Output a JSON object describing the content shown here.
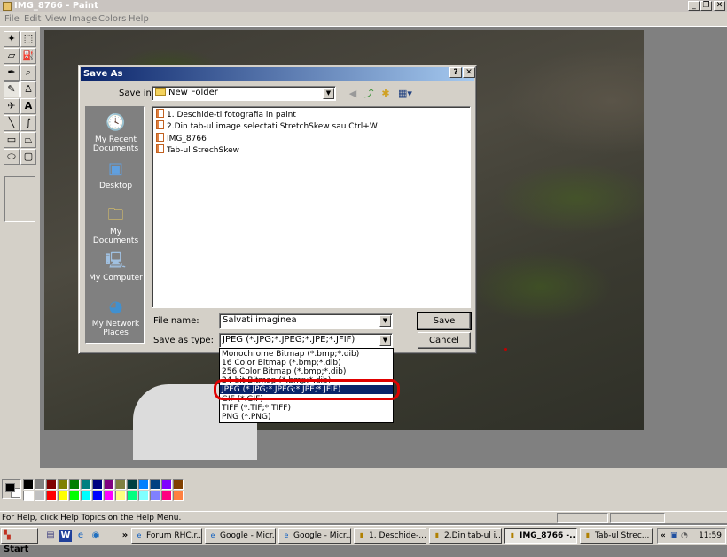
{
  "window": {
    "title": "IMG_8766 - Paint",
    "minimize": "_",
    "restore": "❐",
    "close": "✕"
  },
  "menu": [
    "File",
    "Edit",
    "View",
    "Image",
    "Colors",
    "Help"
  ],
  "toolbox": {
    "tools": [
      "free-form-select",
      "select",
      "eraser",
      "fill-with-color",
      "pick-color",
      "magnifier",
      "pencil",
      "brush",
      "airbrush",
      "text",
      "line",
      "curve",
      "rectangle",
      "polygon",
      "ellipse",
      "rounded-rectangle"
    ],
    "selected": "pencil"
  },
  "dialog": {
    "title": "Save As",
    "help_btn": "?",
    "close_btn": "✕",
    "save_in_label": "Save in:",
    "save_in_value": "New Folder",
    "places": [
      {
        "icon": "recent-documents-icon",
        "label": "My Recent Documents"
      },
      {
        "icon": "desktop-icon",
        "label": "Desktop"
      },
      {
        "icon": "my-documents-icon",
        "label": "My Documents"
      },
      {
        "icon": "my-computer-icon",
        "label": "My Computer"
      },
      {
        "icon": "network-places-icon",
        "label": "My Network Places"
      }
    ],
    "files": [
      "1. Deschide-ti fotografia in paint",
      "2.Din tab-ul image selectati StretchSkew sau Ctrl+W",
      "IMG_8766",
      "Tab-ul StrechSkew"
    ],
    "file_name_label": "File name:",
    "file_name_value": "Salvati imaginea",
    "save_type_label": "Save as type:",
    "save_type_value": "JPEG (*.JPG;*.JPEG;*.JPE;*.JFIF)",
    "save_button": "Save",
    "cancel_button": "Cancel",
    "type_options": [
      "Monochrome Bitmap (*.bmp;*.dib)",
      "16 Color Bitmap (*.bmp;*.dib)",
      "256 Color Bitmap (*.bmp;*.dib)",
      "24-bit Bitmap (*.bmp;*.dib)",
      "JPEG (*.JPG;*.JPEG;*.JPE;*.JFIF)",
      "GIF (*.GIF)",
      "TIFF (*.TIF;*.TIFF)",
      "PNG (*.PNG)"
    ],
    "selected_type_index": 4
  },
  "palette": {
    "primary": "#000000",
    "secondary": "#ffffff",
    "row1": [
      "#000000",
      "#808080",
      "#800000",
      "#808000",
      "#008000",
      "#008080",
      "#000080",
      "#800080",
      "#808040",
      "#004040",
      "#0080ff",
      "#004080",
      "#8000ff",
      "#804000"
    ],
    "row2": [
      "#ffffff",
      "#c0c0c0",
      "#ff0000",
      "#ffff00",
      "#00ff00",
      "#00ffff",
      "#0000ff",
      "#ff00ff",
      "#ffff80",
      "#00ff80",
      "#80ffff",
      "#8080ff",
      "#ff0080",
      "#ff8040"
    ]
  },
  "status": {
    "text": "For Help, click Help Topics on the Help Menu."
  },
  "taskbar": {
    "start": "Start",
    "quicklaunch": [
      "show-desktop-icon",
      "word-icon",
      "ie-icon",
      "media-icon"
    ],
    "overflow": "»",
    "tasks": [
      {
        "label": "Forum RHC.r...",
        "active": false
      },
      {
        "label": "Google - Micr...",
        "active": false
      },
      {
        "label": "Google - Micr...",
        "active": false
      },
      {
        "label": "1. Deschide-...",
        "active": false
      },
      {
        "label": "2.Din tab-ul i...",
        "active": false
      },
      {
        "label": "IMG_8766 -...",
        "active": true
      },
      {
        "label": "Tab-ul Strec...",
        "active": false
      }
    ],
    "tray_chevron": "«",
    "clock": "11:59"
  }
}
